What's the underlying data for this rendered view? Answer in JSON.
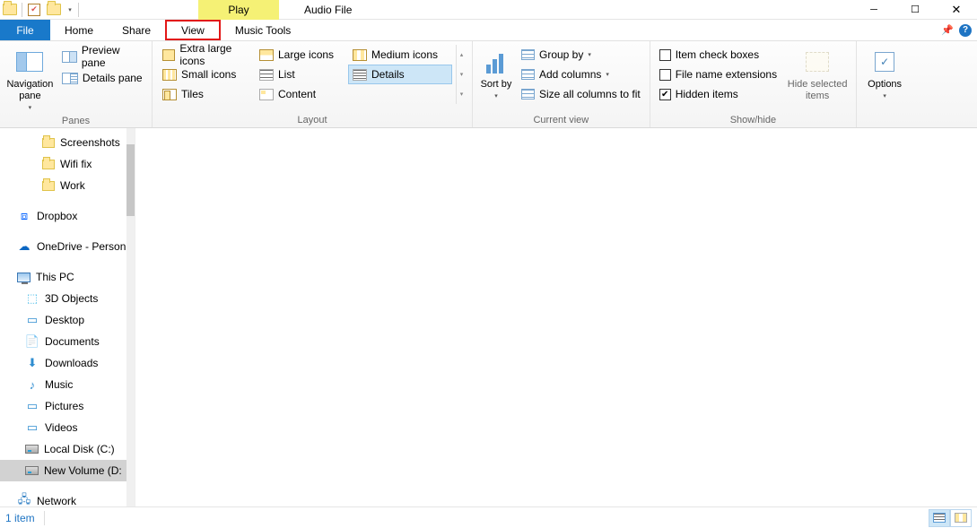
{
  "titlebar": {
    "context_tab": "Play",
    "title": "Audio File"
  },
  "tabs": {
    "file": "File",
    "home": "Home",
    "share": "Share",
    "view": "View",
    "music_tools": "Music Tools"
  },
  "ribbon": {
    "panes": {
      "label": "Panes",
      "navigation_pane": "Navigation pane",
      "preview_pane": "Preview pane",
      "details_pane": "Details pane"
    },
    "layout": {
      "label": "Layout",
      "extra_large_icons": "Extra large icons",
      "large_icons": "Large icons",
      "medium_icons": "Medium icons",
      "small_icons": "Small icons",
      "list": "List",
      "details": "Details",
      "tiles": "Tiles",
      "content": "Content"
    },
    "current_view": {
      "label": "Current view",
      "sort_by": "Sort by",
      "group_by": "Group by",
      "add_columns": "Add columns",
      "size_all_columns": "Size all columns to fit"
    },
    "show_hide": {
      "label": "Show/hide",
      "item_check_boxes": "Item check boxes",
      "file_name_extensions": "File name extensions",
      "hidden_items": "Hidden items",
      "hide_selected_items": "Hide selected items"
    },
    "options": "Options"
  },
  "sidebar": {
    "screenshots": "Screenshots",
    "wifi_fix": "Wifi fix",
    "work": "Work",
    "dropbox": "Dropbox",
    "onedrive": "OneDrive - Person",
    "this_pc": "This PC",
    "objects_3d": "3D Objects",
    "desktop": "Desktop",
    "documents": "Documents",
    "downloads": "Downloads",
    "music": "Music",
    "pictures": "Pictures",
    "videos": "Videos",
    "local_disk": "Local Disk (C:)",
    "new_volume": "New Volume (D:",
    "network": "Network"
  },
  "statusbar": {
    "item_count": "1 item"
  }
}
